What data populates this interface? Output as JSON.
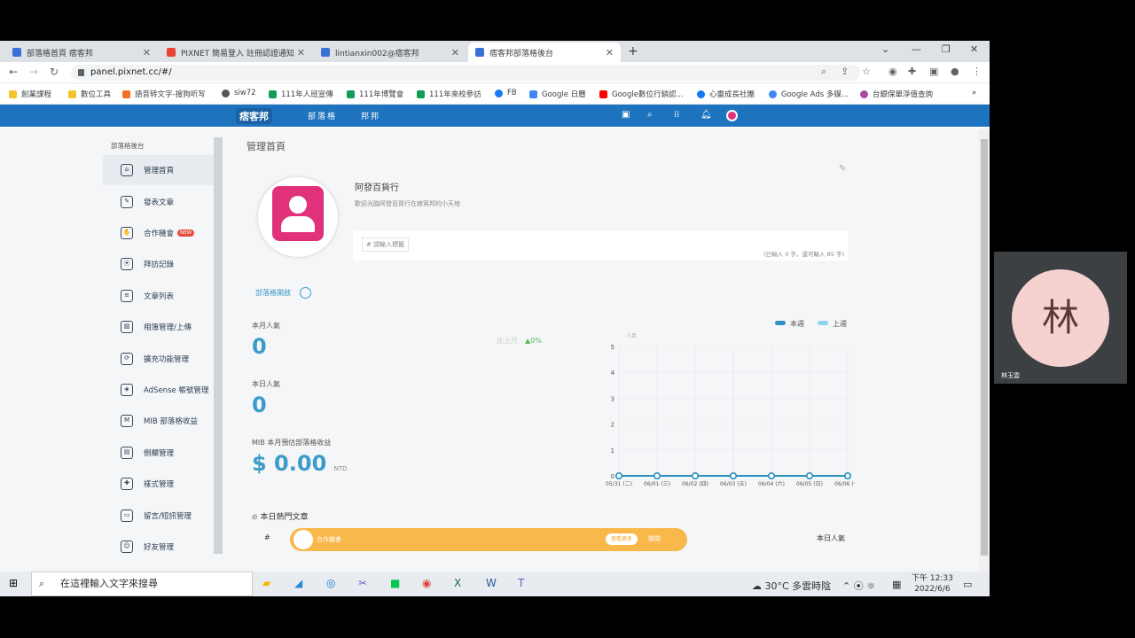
{
  "browser": {
    "tabs": [
      {
        "title": "部落格首頁 痞客邦",
        "color": "#3a6fd8"
      },
      {
        "title": "PIXNET 簡易登入 註冊認證通知",
        "color": "#ea4335"
      },
      {
        "title": "lintianxin002@痞客邦",
        "color": "#3a6fd8"
      },
      {
        "title": "痞客邦部落格後台",
        "color": "#3a6fd8"
      }
    ],
    "url": "panel.pixnet.cc/#/",
    "bookmarks": [
      {
        "label": "創業課程",
        "color": "#f4c430"
      },
      {
        "label": "數位工具",
        "color": "#f4c430"
      },
      {
        "label": "語音转文字-搜狗听写",
        "color": "#f36f21"
      },
      {
        "label": "siw72",
        "color": "#555555"
      },
      {
        "label": "111年人班宣傳",
        "color": "#0f9d58"
      },
      {
        "label": "111年博覽會",
        "color": "#0f9d58"
      },
      {
        "label": "111年來校參訪",
        "color": "#0f9d58"
      },
      {
        "label": "FB",
        "color": "#1877f2"
      },
      {
        "label": "Google 日曆",
        "color": "#4285f4"
      },
      {
        "label": "Google數位行銷認...",
        "color": "#ff0000"
      },
      {
        "label": "心靈成長社團",
        "color": "#1877f2"
      },
      {
        "label": "Google Ads 多媒...",
        "color": "#4285f4"
      },
      {
        "label": "台銀保單淨值查詢",
        "color": "#a64ca6"
      }
    ]
  },
  "site": {
    "logo": "痞客邦",
    "nav": [
      "部落格",
      "邦邦"
    ]
  },
  "sidebar": {
    "title": "部落格後台",
    "items": [
      {
        "label": "管理首頁",
        "icon": "home-icon"
      },
      {
        "label": "發表文章",
        "icon": "edit-icon"
      },
      {
        "label": "合作機會",
        "icon": "handshake-icon",
        "badge": "NEW"
      },
      {
        "label": "拜訪記錄",
        "icon": "pin-icon"
      },
      {
        "label": "文章列表",
        "icon": "list-icon"
      },
      {
        "label": "相簿管理/上傳",
        "icon": "image-icon"
      },
      {
        "label": "擴充功能管理",
        "icon": "puzzle-icon"
      },
      {
        "label": "AdSense 帳號管理",
        "icon": "adsense-icon"
      },
      {
        "label": "MIB 部落格收益",
        "icon": "mib-icon"
      },
      {
        "label": "側欄管理",
        "icon": "layout-icon"
      },
      {
        "label": "樣式管理",
        "icon": "style-icon"
      },
      {
        "label": "留言/短訊管理",
        "icon": "message-icon"
      },
      {
        "label": "好友管理",
        "icon": "friends-icon"
      }
    ]
  },
  "main": {
    "page_title": "管理首頁",
    "blog_name": "阿發百貨行",
    "blog_desc": "歡迎光臨阿發百貨行在痞客邦的小天地",
    "tag_placeholder": "# 請輸入標籤",
    "tag_count": "(已輸入 0 字，還可輸入 85 字)",
    "status_label": "部落格開啟",
    "stats": [
      {
        "label": "本月人氣",
        "value": "0"
      },
      {
        "label": "本日人氣",
        "value": "0"
      },
      {
        "label": "MIB 本月預估部落格收益",
        "value": "$ 0.00",
        "unit": "NTD"
      }
    ],
    "compare": {
      "label": "比上月",
      "value": "▲0%"
    },
    "hot_title": "本日熱門文章",
    "hot_col_left": "#",
    "hot_col_right": "本日人氣",
    "banner": {
      "label": "合作機會",
      "button": "查看更多",
      "close": "關閉"
    }
  },
  "chart_data": {
    "type": "line",
    "ylabel": "人氣",
    "ylim": [
      0,
      5
    ],
    "yticks": [
      0,
      1,
      2,
      3,
      4,
      5
    ],
    "x": [
      "05/31 (二)",
      "06/01 (三)",
      "06/02 (四)",
      "06/03 (五)",
      "06/04 (六)",
      "06/05 (日)",
      "06/06 (一)"
    ],
    "series": [
      {
        "name": "本週",
        "values": [
          0,
          0,
          0,
          0,
          0,
          0,
          0
        ],
        "color": "#2e8fc2"
      },
      {
        "name": "上週",
        "values": [
          0,
          0,
          0,
          0,
          0,
          0,
          0
        ],
        "color": "#8fd3ef"
      }
    ],
    "legend": "top-right"
  },
  "taskbar": {
    "search_placeholder": "在這裡輸入文字來搜尋",
    "weather": "30°C 多雲時陰",
    "time": "下午 12:33",
    "date": "2022/6/6"
  },
  "video": {
    "avatar_char": "林",
    "name": "林玉雲"
  }
}
